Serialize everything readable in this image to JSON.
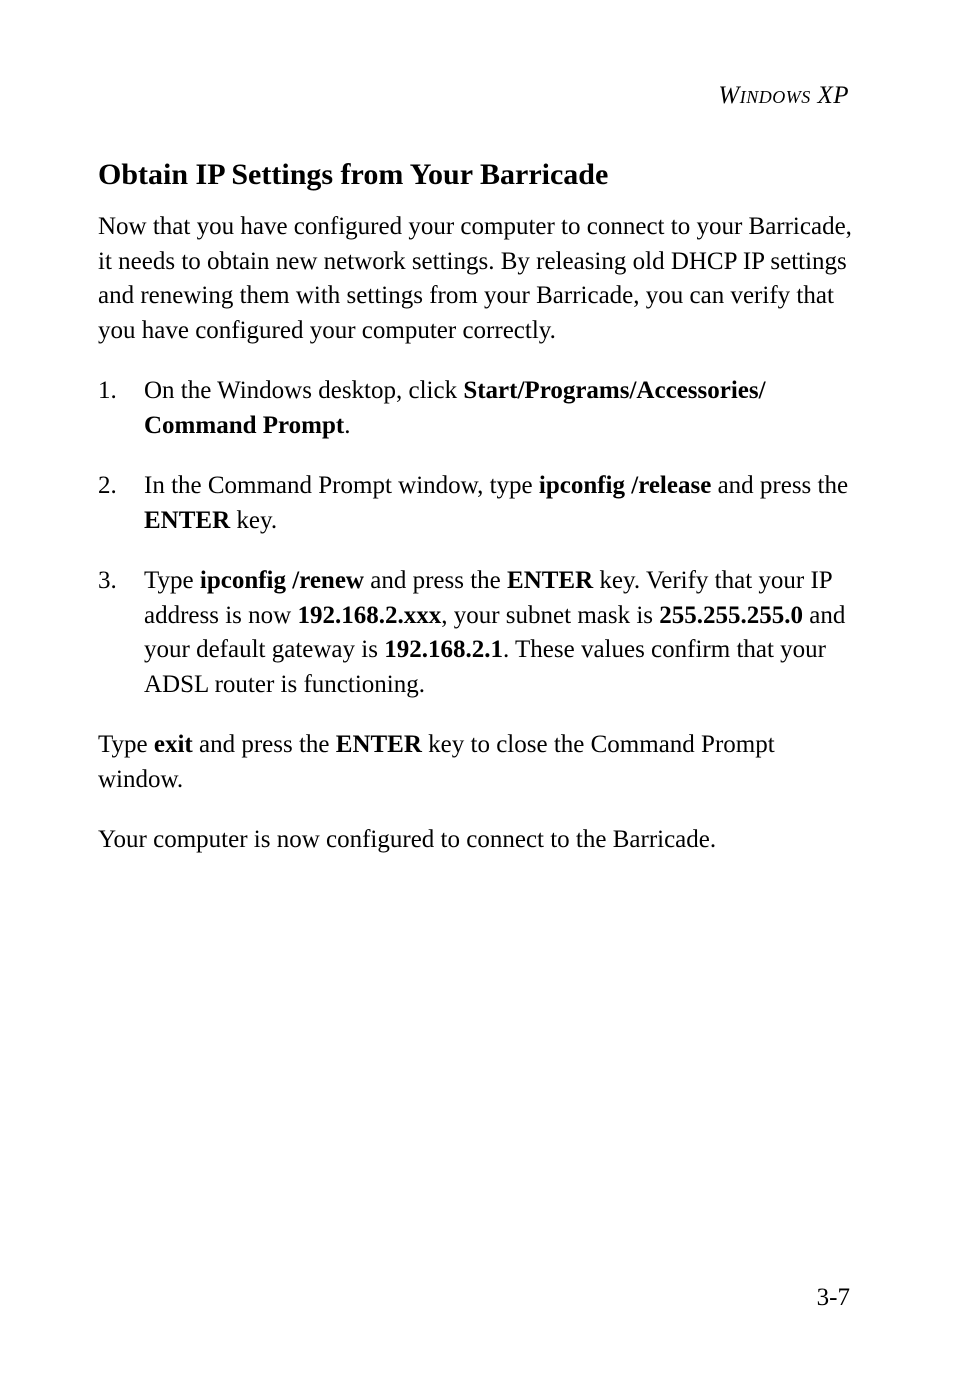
{
  "running_head": "Windows XP",
  "heading": "Obtain IP Settings from Your Barricade",
  "intro": "Now that you have configured your computer to connect to your Barricade, it needs to obtain new network settings. By releasing old DHCP IP settings and renewing them with settings from your Barricade, you can verify that you have configured your computer correctly.",
  "steps": [
    {
      "num": "1.",
      "pre": "On the Windows desktop, click ",
      "b1": "Start/Programs/Accessories/ Command Prompt",
      "post": "."
    },
    {
      "num": "2.",
      "pre": "In the Command Prompt window, type ",
      "b1": "ipconfig /release",
      "mid1": " and press the ",
      "b2": "ENTER",
      "post": " key."
    },
    {
      "num": "3.",
      "pre": "Type ",
      "b1": "ipconfig /renew",
      "mid1": " and press the ",
      "b2": "ENTER",
      "mid2": " key. Verify that your IP address is now ",
      "b3": "192.168.2.xxx",
      "mid3": ", your subnet mask is ",
      "b4": "255.255.255.0",
      "mid4": " and your default gateway is ",
      "b5": "192.168.2.1",
      "post": ". These values confirm that your ADSL router is functioning."
    }
  ],
  "exit_para": {
    "pre": "Type ",
    "b1": "exit",
    "mid1": " and press the ",
    "b2": "ENTER",
    "post": " key to close the Command Prompt window."
  },
  "final_para": "Your computer is now configured to connect to the Barricade.",
  "page_number": "3-7"
}
